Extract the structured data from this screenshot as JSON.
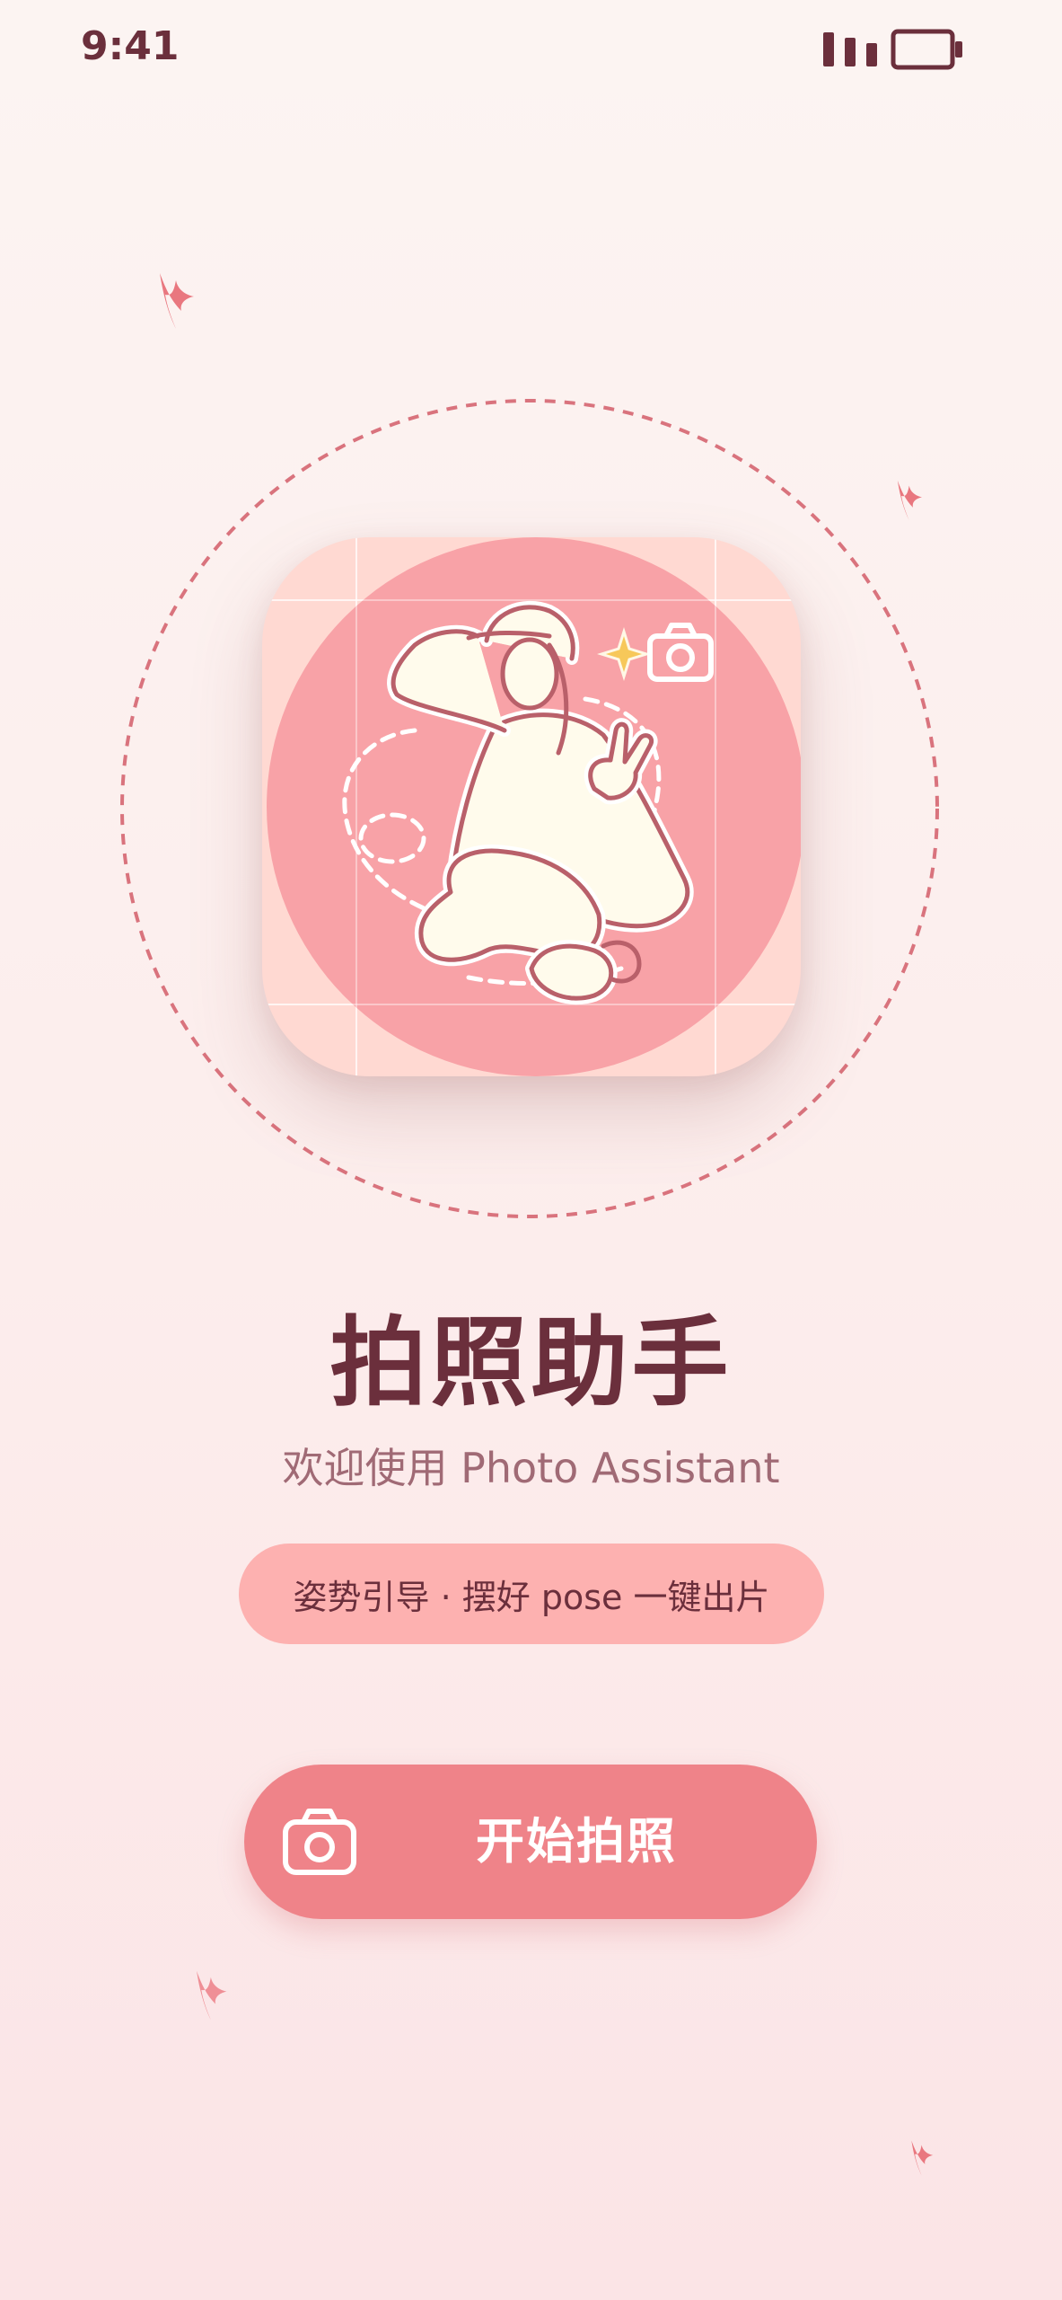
{
  "status_bar": {
    "time": "9:41",
    "signal_icon": "signal-bars-icon",
    "battery_icon": "battery-icon"
  },
  "decor": {
    "petal_icon": "petal-icon",
    "ring_color": "#d9737d"
  },
  "app": {
    "icon_name": "pose-photo-app-icon",
    "title": "拍照助手",
    "subtitle": "欢迎使用 Photo Assistant",
    "tagline": "姿势引导 · 摆好 pose 一键出片"
  },
  "actions": {
    "start_label": "开始拍照",
    "start_icon": "camera-icon"
  },
  "colors": {
    "title": "#6b2f3c",
    "subtitle": "#a06a75",
    "chip_bg": "#fdb1b0",
    "button_bg": "#ef8389",
    "icon_circle": "#f8a2a7",
    "icon_bg": "#ffd9d2"
  }
}
